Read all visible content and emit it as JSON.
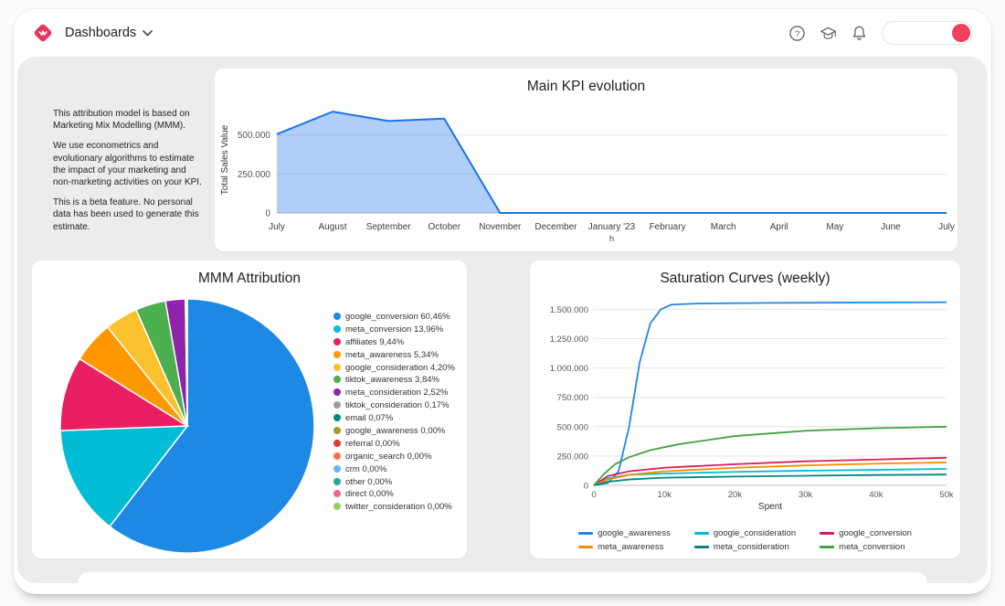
{
  "header": {
    "nav_label": "Dashboards",
    "logo_color": "#e8355c",
    "avatar_color": "#f0415f",
    "icons": [
      {
        "name": "help-icon"
      },
      {
        "name": "academy-icon"
      },
      {
        "name": "notifications-bell-icon"
      },
      {
        "name": "chevron-down-icon"
      }
    ],
    "search_placeholder": ""
  },
  "info_panel": {
    "paragraphs": [
      "This attribution model is based on Marketing Mix Modelling (MMM).",
      "We use econometrics and evolutionary algorithms to estimate the impact of your marketing and non-marketing activities on your KPI.",
      "This is a beta feature. No personal data has been used to generate this estimate."
    ]
  },
  "chart_data": [
    {
      "id": "kpi",
      "type": "area",
      "title": "Main KPI evolution",
      "ylabel": "Total Sales Value",
      "categories": [
        "July",
        "August",
        "September",
        "October",
        "November",
        "December",
        "January '23",
        "February",
        "March",
        "April",
        "May",
        "June",
        "July"
      ],
      "x_sub_label": {
        "index": 6,
        "text": "h"
      },
      "values": [
        505000,
        650000,
        590000,
        605000,
        0,
        0,
        0,
        0,
        0,
        0,
        0,
        0,
        0
      ],
      "yticks": [
        {
          "v": 0,
          "label": "0"
        },
        {
          "v": 250000,
          "label": "250.000"
        },
        {
          "v": 500000,
          "label": "500.000"
        }
      ],
      "ymax": 680000,
      "line_color": "#1a73e8",
      "fill_color": "rgba(30,115,232,0.35)",
      "grid": true,
      "legend_position": "none"
    },
    {
      "id": "attribution",
      "type": "pie",
      "title": "MMM Attribution",
      "legend_position": "right",
      "slices": [
        {
          "label": "google_conversion",
          "pct_label": "60,46%",
          "value": 60.46,
          "color": "#1e88e5"
        },
        {
          "label": "meta_conversion",
          "pct_label": "13,96%",
          "value": 13.96,
          "color": "#00bcd4"
        },
        {
          "label": "affiliates",
          "pct_label": "9,44%",
          "value": 9.44,
          "color": "#e91e63"
        },
        {
          "label": "meta_awareness",
          "pct_label": "5,34%",
          "value": 5.34,
          "color": "#ff9800"
        },
        {
          "label": "google_consideration",
          "pct_label": "4,20%",
          "value": 4.2,
          "color": "#fbc02d"
        },
        {
          "label": "tiktok_awareness",
          "pct_label": "3,84%",
          "value": 3.84,
          "color": "#4caf50"
        },
        {
          "label": "meta_consideration",
          "pct_label": "2,52%",
          "value": 2.52,
          "color": "#8e24aa"
        },
        {
          "label": "tiktok_consideration",
          "pct_label": "0,17%",
          "value": 0.17,
          "color": "#9e9e9e"
        },
        {
          "label": "email",
          "pct_label": "0,07%",
          "value": 0.07,
          "color": "#00897b"
        },
        {
          "label": "google_awareness",
          "pct_label": "0,00%",
          "value": 0,
          "color": "#9e9d24"
        },
        {
          "label": "referral",
          "pct_label": "0,00%",
          "value": 0,
          "color": "#e53935"
        },
        {
          "label": "organic_search",
          "pct_label": "0,00%",
          "value": 0,
          "color": "#ff7043"
        },
        {
          "label": "crm",
          "pct_label": "0,00%",
          "value": 0,
          "color": "#64b5f6"
        },
        {
          "label": "other",
          "pct_label": "0,00%",
          "value": 0,
          "color": "#26a69a"
        },
        {
          "label": "direct",
          "pct_label": "0,00%",
          "value": 0,
          "color": "#f06292"
        },
        {
          "label": "twitter_consideration",
          "pct_label": "0,00%",
          "value": 0,
          "color": "#9ccc65"
        }
      ]
    },
    {
      "id": "saturation",
      "type": "line",
      "title": "Saturation Curves (weekly)",
      "xlabel": "Spent",
      "xmax": 50000,
      "xticks": [
        {
          "v": 0,
          "label": "0"
        },
        {
          "v": 10000,
          "label": "10k"
        },
        {
          "v": 20000,
          "label": "20k"
        },
        {
          "v": 30000,
          "label": "30k"
        },
        {
          "v": 40000,
          "label": "40k"
        },
        {
          "v": 50000,
          "label": "50k"
        }
      ],
      "ymax": 1620000,
      "yticks": [
        {
          "v": 0,
          "label": "0"
        },
        {
          "v": 250000,
          "label": "250.000"
        },
        {
          "v": 500000,
          "label": "500.000"
        },
        {
          "v": 750000,
          "label": "750.000"
        },
        {
          "v": 1000000,
          "label": "1.000.000"
        },
        {
          "v": 1250000,
          "label": "1.250.000"
        },
        {
          "v": 1500000,
          "label": "1.500.000"
        }
      ],
      "grid": true,
      "legend_position": "bottom",
      "series": [
        {
          "name": "google_awareness",
          "color": "#1e88e5",
          "points": [
            [
              0,
              0
            ],
            [
              2000,
              20000
            ],
            [
              3500,
              120000
            ],
            [
              5000,
              500000
            ],
            [
              6500,
              1050000
            ],
            [
              8000,
              1380000
            ],
            [
              9500,
              1500000
            ],
            [
              11000,
              1540000
            ],
            [
              15000,
              1550000
            ],
            [
              25000,
              1555000
            ],
            [
              50000,
              1560000
            ]
          ]
        },
        {
          "name": "google_consideration",
          "color": "#00bcd4",
          "points": [
            [
              0,
              0
            ],
            [
              2000,
              60000
            ],
            [
              5000,
              90000
            ],
            [
              10000,
              100000
            ],
            [
              20000,
              115000
            ],
            [
              30000,
              125000
            ],
            [
              40000,
              132000
            ],
            [
              50000,
              140000
            ]
          ]
        },
        {
          "name": "google_conversion",
          "color": "#d81b60",
          "points": [
            [
              0,
              0
            ],
            [
              2000,
              80000
            ],
            [
              5000,
              120000
            ],
            [
              10000,
              150000
            ],
            [
              20000,
              180000
            ],
            [
              30000,
              205000
            ],
            [
              40000,
              220000
            ],
            [
              50000,
              235000
            ]
          ]
        },
        {
          "name": "meta_awareness",
          "color": "#fb8c00",
          "points": [
            [
              0,
              0
            ],
            [
              2000,
              50000
            ],
            [
              5000,
              90000
            ],
            [
              10000,
              120000
            ],
            [
              20000,
              150000
            ],
            [
              30000,
              170000
            ],
            [
              40000,
              185000
            ],
            [
              50000,
              195000
            ]
          ]
        },
        {
          "name": "meta_consideration",
          "color": "#00897b",
          "points": [
            [
              0,
              0
            ],
            [
              2000,
              30000
            ],
            [
              5000,
              50000
            ],
            [
              10000,
              65000
            ],
            [
              20000,
              75000
            ],
            [
              30000,
              82000
            ],
            [
              40000,
              88000
            ],
            [
              50000,
              92000
            ]
          ]
        },
        {
          "name": "meta_conversion",
          "color": "#43a047",
          "points": [
            [
              0,
              0
            ],
            [
              1500,
              100000
            ],
            [
              3000,
              180000
            ],
            [
              5000,
              240000
            ],
            [
              8000,
              300000
            ],
            [
              12000,
              350000
            ],
            [
              20000,
              420000
            ],
            [
              30000,
              465000
            ],
            [
              40000,
              487000
            ],
            [
              50000,
              500000
            ]
          ]
        }
      ]
    }
  ]
}
